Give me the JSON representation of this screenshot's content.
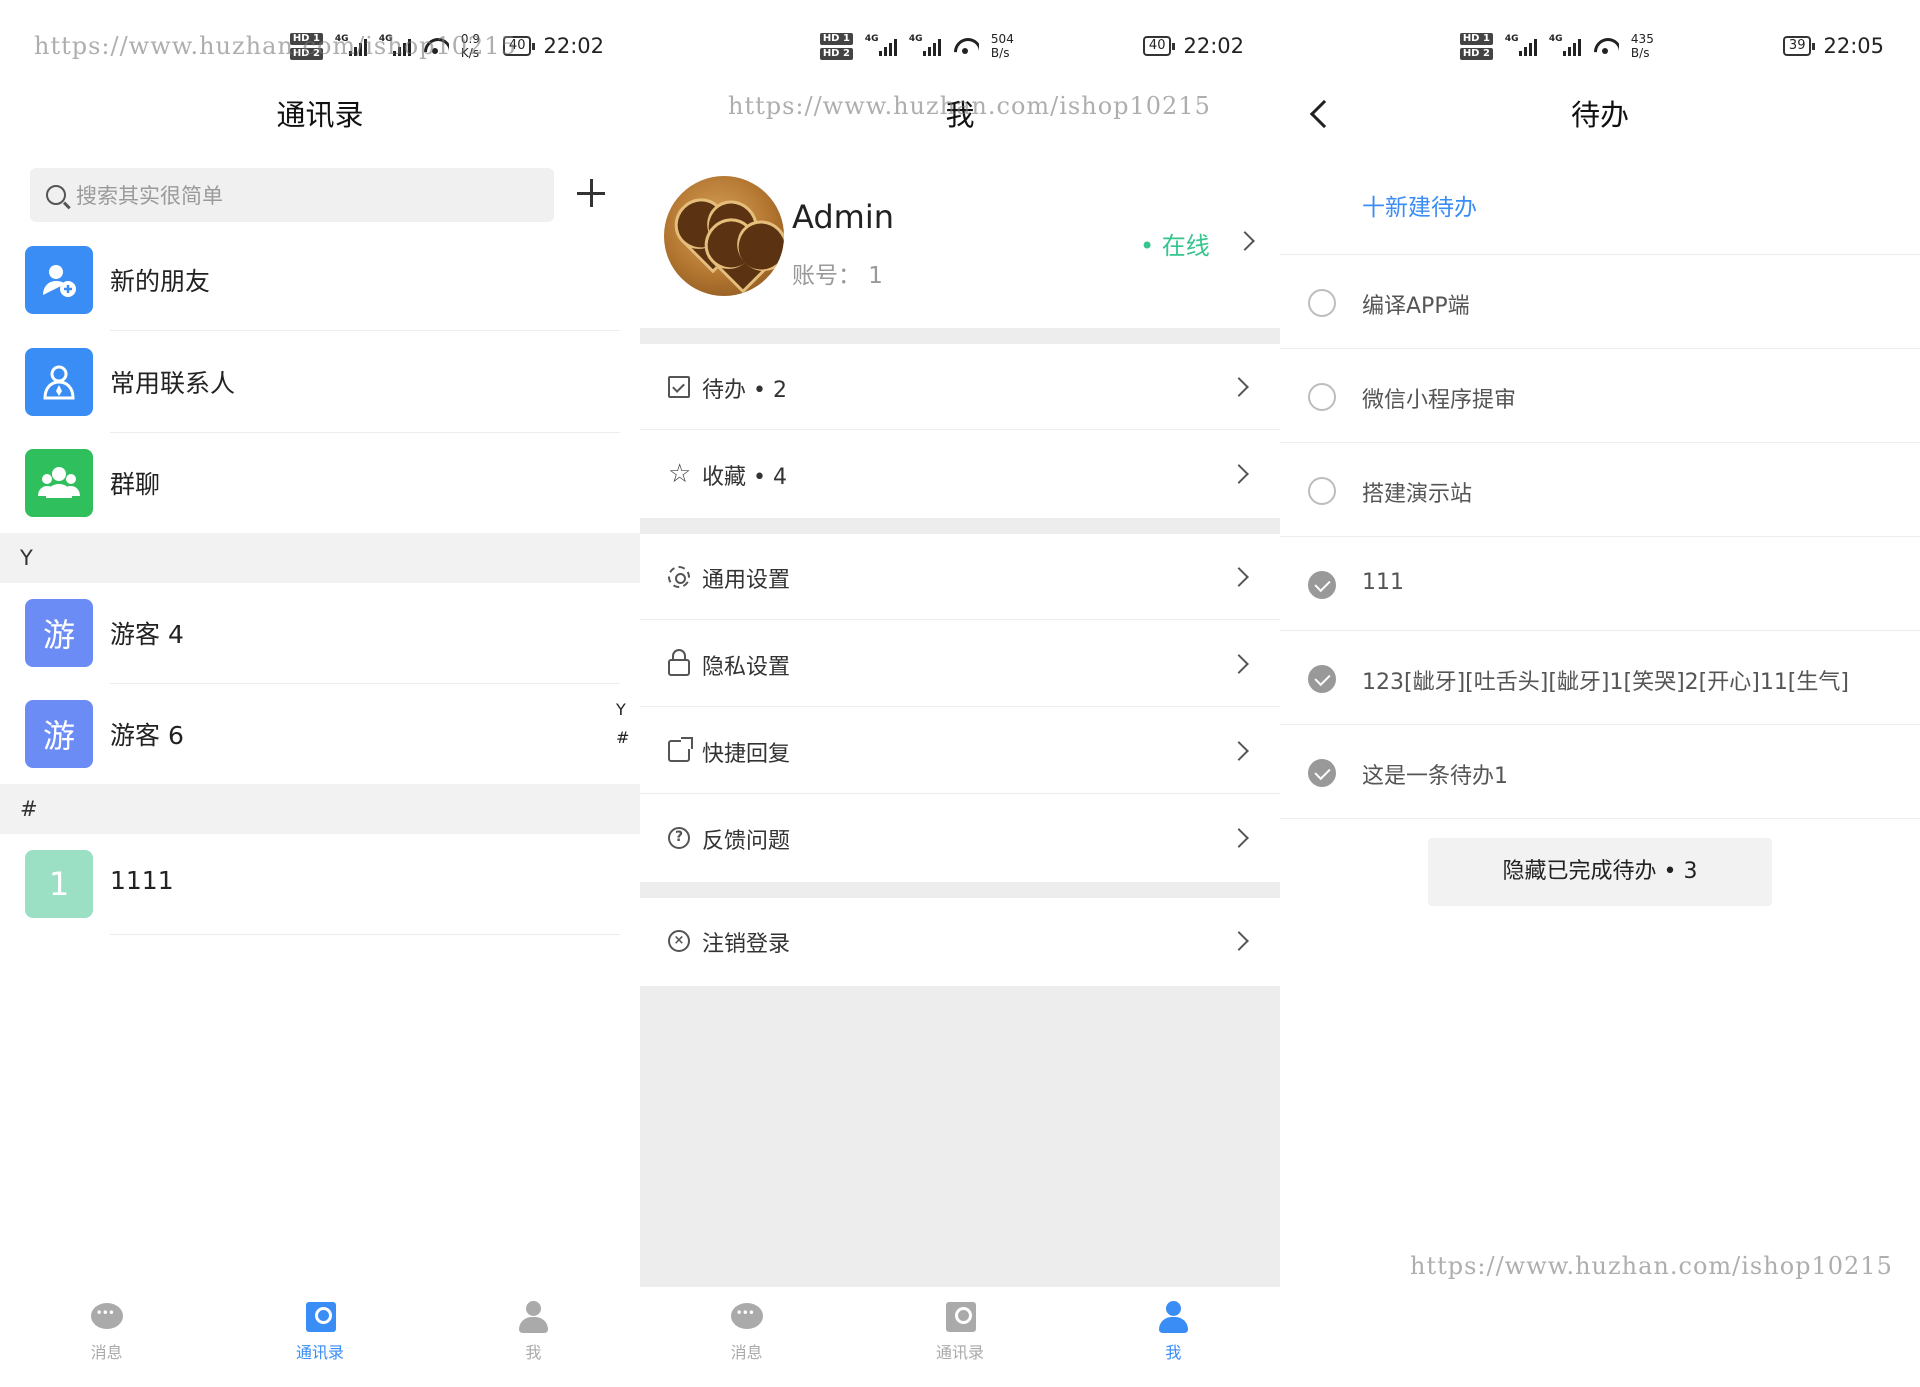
{
  "status_bars": [
    {
      "hd1": "HD 1",
      "hd2": "HD 2",
      "net1": "4G",
      "net2": "4G",
      "speed": "0.9\nK/s",
      "battery": "40",
      "time": "22:02"
    },
    {
      "hd1": "HD 1",
      "hd2": "HD 2",
      "net1": "4G",
      "net2": "4G",
      "speed": "504\nB/s",
      "battery": "40",
      "time": "22:02"
    },
    {
      "hd1": "HD 1",
      "hd2": "HD 2",
      "net1": "4G",
      "net2": "4G",
      "speed": "435\nB/s",
      "battery": "39",
      "time": "22:05"
    }
  ],
  "watermark": "https://www.huzhan.com/ishop10215",
  "contacts": {
    "title": "通讯录",
    "search_placeholder": "搜索其实很简单",
    "top_items": [
      {
        "label": "新的朋友",
        "icon": "add-user-icon",
        "color": "#3a8df5"
      },
      {
        "label": "常用联系人",
        "icon": "contacts-icon",
        "color": "#3a8df5"
      },
      {
        "label": "群聊",
        "icon": "group-icon",
        "color": "#2fbf5d"
      }
    ],
    "section_y": "Y",
    "y_items": [
      {
        "avatar_text": "游",
        "label": "游客 4",
        "color": "#6b8cf5"
      },
      {
        "avatar_text": "游",
        "label": "游客 6",
        "color": "#6b8cf5"
      }
    ],
    "section_hash": "#",
    "hash_items": [
      {
        "avatar_text": "1",
        "label": "1111",
        "color": "#9be0c4"
      }
    ],
    "index": [
      "Y",
      "#"
    ]
  },
  "me": {
    "title": "我",
    "name": "Admin",
    "account": "账号：  1",
    "status": "在线",
    "status_color": "#35c58e",
    "menu": [
      {
        "label": "待办",
        "badge": "•  2",
        "icon": "checkbox-icon"
      },
      {
        "label": "收藏",
        "badge": "•  4",
        "icon": "star-icon"
      },
      {
        "label": "通用设置",
        "icon": "gear-icon"
      },
      {
        "label": "隐私设置",
        "icon": "lock-icon"
      },
      {
        "label": "快捷回复",
        "icon": "share-icon"
      },
      {
        "label": "反馈问题",
        "icon": "help-icon"
      },
      {
        "label": "注销登录",
        "icon": "logout-icon"
      }
    ]
  },
  "todo": {
    "title": "待办",
    "new_label": "十新建待办",
    "items": [
      {
        "text": "编译APP端",
        "done": false
      },
      {
        "text": "微信小程序提审",
        "done": false
      },
      {
        "text": "搭建演示站",
        "done": false
      },
      {
        "text": "111",
        "done": true
      },
      {
        "text": "123[龇牙][吐舌头][龇牙]1[笑哭]2[开心]11[生气]",
        "done": true
      },
      {
        "text": "这是一条待办1",
        "done": true
      }
    ],
    "hide_label": "隐藏已完成待办 • 3"
  },
  "tabbar": {
    "labels": [
      "消息",
      "通讯录",
      "我"
    ],
    "active_color": "#3a8df5",
    "inactive_color": "#aaaaaa"
  }
}
